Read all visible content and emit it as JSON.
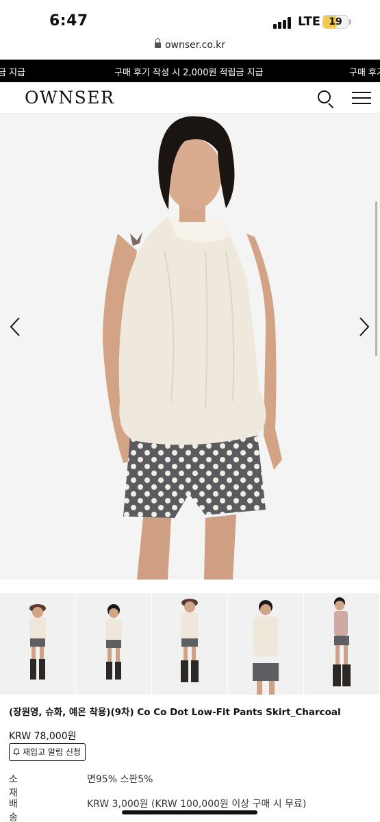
{
  "status_bar": {
    "time": "6:47",
    "network": "LTE",
    "battery": "19",
    "battery_color": "#f2c94c"
  },
  "browser": {
    "url": "ownser.co.kr"
  },
  "promo_banner": {
    "text_left": "금 지급",
    "text_center": "구매 후기 작성 시 2,000원 적립금 지급",
    "text_right": "구매 후기",
    "background": "#000000"
  },
  "header": {
    "logo": "OWNSER",
    "icons": [
      "search-icon",
      "hamburger-menu-icon"
    ]
  },
  "hero": {
    "icons": [
      "chevron-left-icon",
      "chevron-right-icon"
    ]
  },
  "thumbnails": {
    "count": 5
  },
  "product": {
    "title": "(장원영, 슈화, 예온 착용)(9차) Co Co Dot Low-Fit Pants Skirt_Charcoal",
    "price": "KRW 78,000원",
    "restock_button": "재입고 알림 신청",
    "details": [
      {
        "label": "소재",
        "value": "면95% 스판5%"
      },
      {
        "label": "배송비",
        "value": "KRW 3,000원 (KRW 100,000원 이상 구매 시 무료)"
      }
    ]
  }
}
